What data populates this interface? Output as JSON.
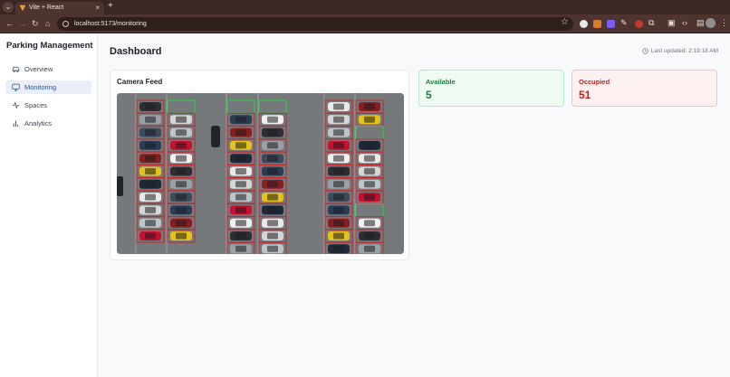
{
  "browser": {
    "tab_title": "Vite + React",
    "tab_close": "×",
    "new_tab": "+",
    "url": "localhost:5173/monitoring"
  },
  "sidebar": {
    "brand": "Parking Management",
    "items": [
      {
        "label": "Overview",
        "icon": "car-icon",
        "active": false
      },
      {
        "label": "Monitoring",
        "icon": "monitor-icon",
        "active": true
      },
      {
        "label": "Spaces",
        "icon": "activity-icon",
        "active": false
      },
      {
        "label": "Analytics",
        "icon": "bar-chart-icon",
        "active": false
      }
    ]
  },
  "header": {
    "title": "Dashboard",
    "last_updated": "Last updated: 2:19:18 AM"
  },
  "camera": {
    "title": "Camera Feed"
  },
  "stats": {
    "available": {
      "label": "Available",
      "value": "5",
      "color": "#1e7d3c"
    },
    "occupied": {
      "label": "Occupied",
      "value": "51",
      "color": "#b4261f"
    }
  }
}
